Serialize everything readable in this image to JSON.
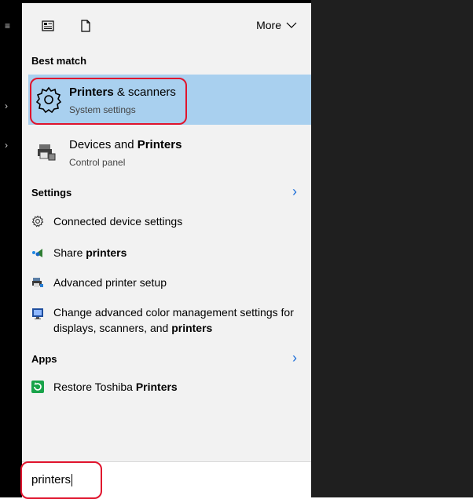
{
  "header": {
    "more_label": "More",
    "icons": [
      "news-icon",
      "document-icon"
    ]
  },
  "best_match": {
    "label": "Best match",
    "item": {
      "title_bold": "Printers",
      "title_rest": " & scanners",
      "subtitle": "System settings",
      "icon": "gear-icon"
    }
  },
  "second_item": {
    "title_plain": "Devices and ",
    "title_bold": "Printers",
    "subtitle": "Control panel",
    "icon": "printer-devices-icon"
  },
  "settings": {
    "label": "Settings",
    "items": [
      {
        "text_plain": "Connected device settings",
        "text_bold": "",
        "icon": "gear-small-icon"
      },
      {
        "text_plain": "Share ",
        "text_bold": "printers",
        "icon": "share-icon"
      },
      {
        "text_plain": "Advanced printer setup",
        "text_bold": "",
        "icon": "printer-setup-icon"
      },
      {
        "text_plain": "Change advanced color management settings for displays, scanners, and ",
        "text_bold": "printers",
        "icon": "display-color-icon"
      }
    ]
  },
  "apps": {
    "label": "Apps",
    "items": [
      {
        "text_plain": "Restore Toshiba ",
        "text_bold": "Printers",
        "icon": "restore-icon"
      }
    ]
  },
  "search": {
    "value": "printers"
  }
}
